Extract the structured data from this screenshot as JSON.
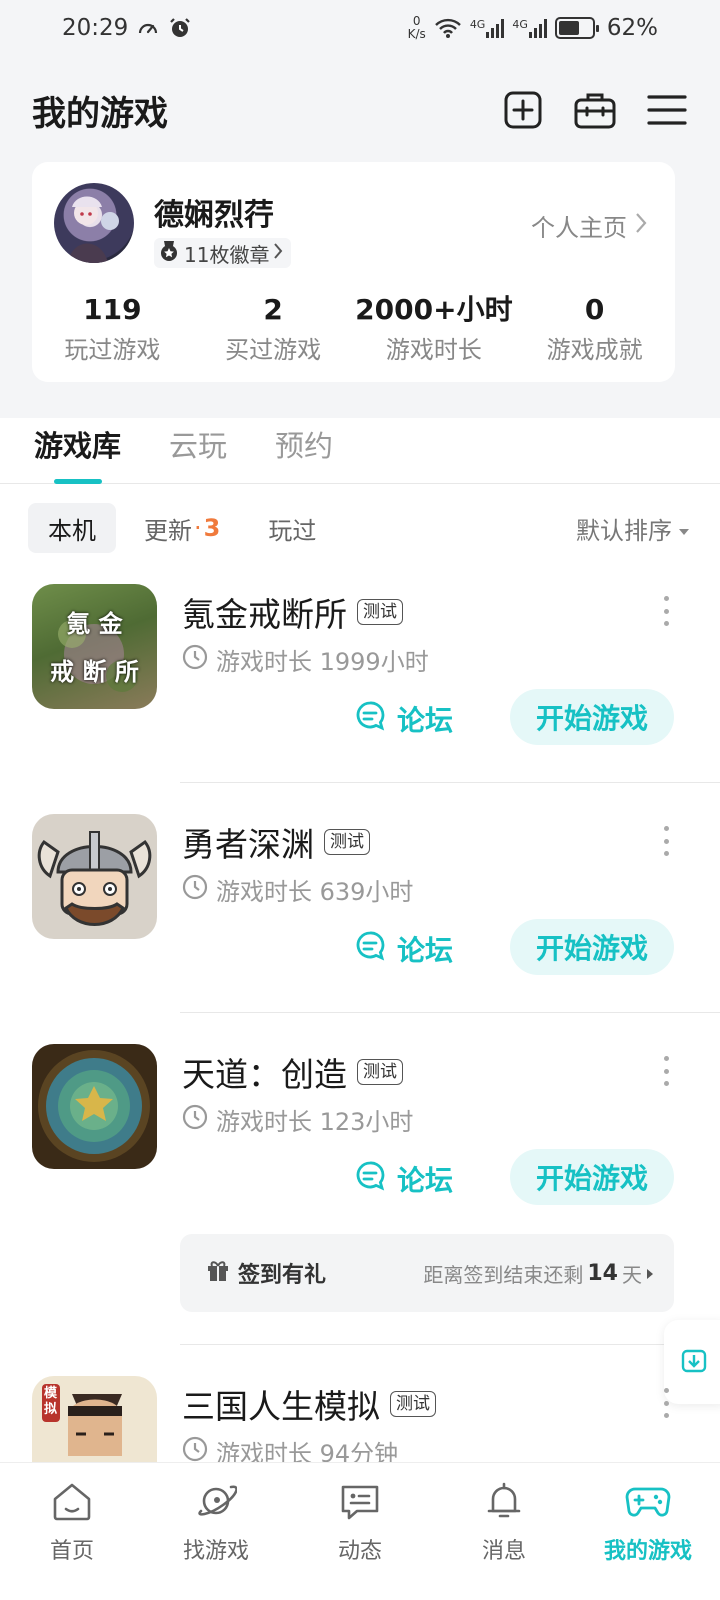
{
  "status_bar": {
    "time": "20:29",
    "net_speed_value": "0",
    "net_speed_unit": "K/s",
    "sig1": "4G",
    "sig2": "4G",
    "battery": "62%"
  },
  "header": {
    "title": "我的游戏"
  },
  "profile": {
    "username": "德娴烈荇",
    "badges": "11枚徽章",
    "homepage": "个人主页",
    "stats": [
      {
        "value": "119",
        "label": "玩过游戏"
      },
      {
        "value": "2",
        "label": "买过游戏"
      },
      {
        "value": "2000+小时",
        "label": "游戏时长"
      },
      {
        "value": "0",
        "label": "游戏成就"
      }
    ]
  },
  "tabs": [
    "游戏库",
    "云玩",
    "预约"
  ],
  "filters": {
    "local": "本机",
    "update_label": "更新",
    "update_dot": "·",
    "update_count": "3",
    "played": "玩过",
    "sort": "默认排序"
  },
  "games": [
    {
      "name": "氪金戒断所",
      "tag": "测试",
      "time": "游戏时长 1999小时",
      "forum": "论坛",
      "start": "开始游戏",
      "icon_text_1": "氪 金",
      "icon_text_2": "戒 断 所"
    },
    {
      "name": "勇者深渊",
      "tag": "测试",
      "time": "游戏时长 639小时",
      "forum": "论坛",
      "start": "开始游戏"
    },
    {
      "name": "天道：创造",
      "tag": "测试",
      "time": "游戏时长 123小时",
      "forum": "论坛",
      "start": "开始游戏"
    },
    {
      "name": "三国人生模拟",
      "tag": "测试",
      "time": "游戏时长 94分钟",
      "icon_text": "模拟"
    }
  ],
  "signin": {
    "title": "签到有礼",
    "info_prefix": "距离签到结束还剩",
    "days": "14",
    "info_suffix": "天"
  },
  "bottom_nav": [
    {
      "label": "首页",
      "icon": "home-icon"
    },
    {
      "label": "找游戏",
      "icon": "planet-icon"
    },
    {
      "label": "动态",
      "icon": "chat-icon"
    },
    {
      "label": "消息",
      "icon": "bell-icon"
    },
    {
      "label": "我的游戏",
      "icon": "gamepad-icon"
    }
  ],
  "colors": {
    "accent": "#17c1c4",
    "update_count": "#f07a3c",
    "background": "#f4f5f7"
  }
}
